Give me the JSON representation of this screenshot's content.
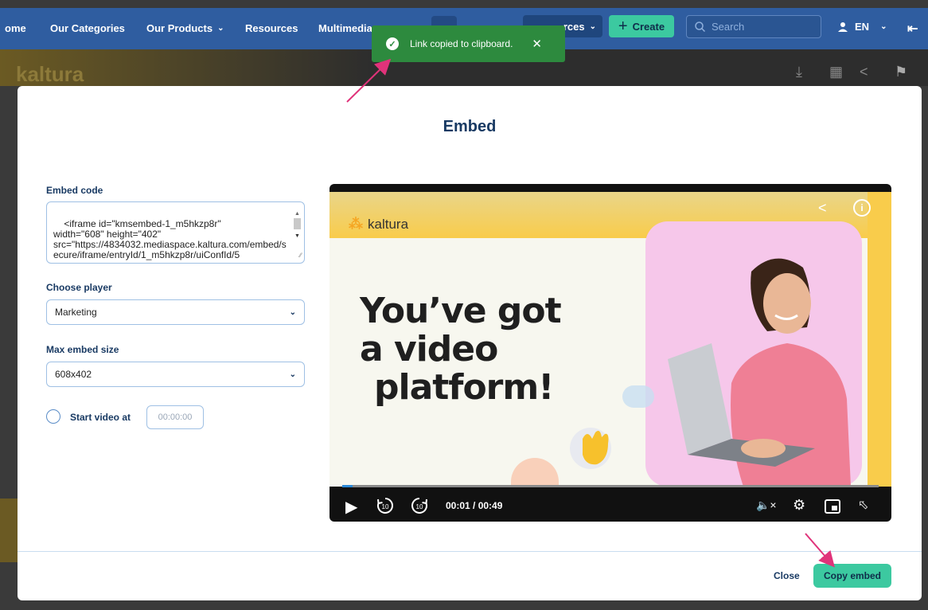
{
  "topnav": {
    "home": "ome",
    "categories": "Our Categories",
    "products": "Our Products",
    "resources": "Resources",
    "multimedia": "Multimedia",
    "resources_btn": "rces",
    "create": "Create",
    "search_placeholder": "Search",
    "language": "EN"
  },
  "toast": {
    "message": "Link copied to clipboard."
  },
  "modal": {
    "title": "Embed",
    "embed_code_label": "Embed code",
    "embed_code": "<iframe id=\"kmsembed-1_m5hkzp8r\"\nwidth=\"608\" height=\"402\"\nsrc=\"https://4834032.mediaspace.kaltura.com/embed/secure/iframe/entryId/1_m5hkzp8r/uiConfId/5",
    "choose_player_label": "Choose player",
    "choose_player_value": "Marketing",
    "max_size_label": "Max embed size",
    "max_size_value": "608x402",
    "start_video_label": "Start video at",
    "start_time_placeholder": "00:00:00",
    "close": "Close",
    "copy_embed": "Copy embed"
  },
  "player": {
    "brand": "kaltura",
    "headline_1": "You’ve got",
    "headline_2": "a video",
    "headline_3": "platform!",
    "time": "00:01 / 00:49",
    "progress_fraction": 0.02
  },
  "background": {
    "logo": "kaltura"
  },
  "colors": {
    "nav_bg": "#2f5da0",
    "accent": "#3cc9a0",
    "toast": "#2d8a3e",
    "title": "#193a63",
    "arrow": "#e0337a"
  }
}
